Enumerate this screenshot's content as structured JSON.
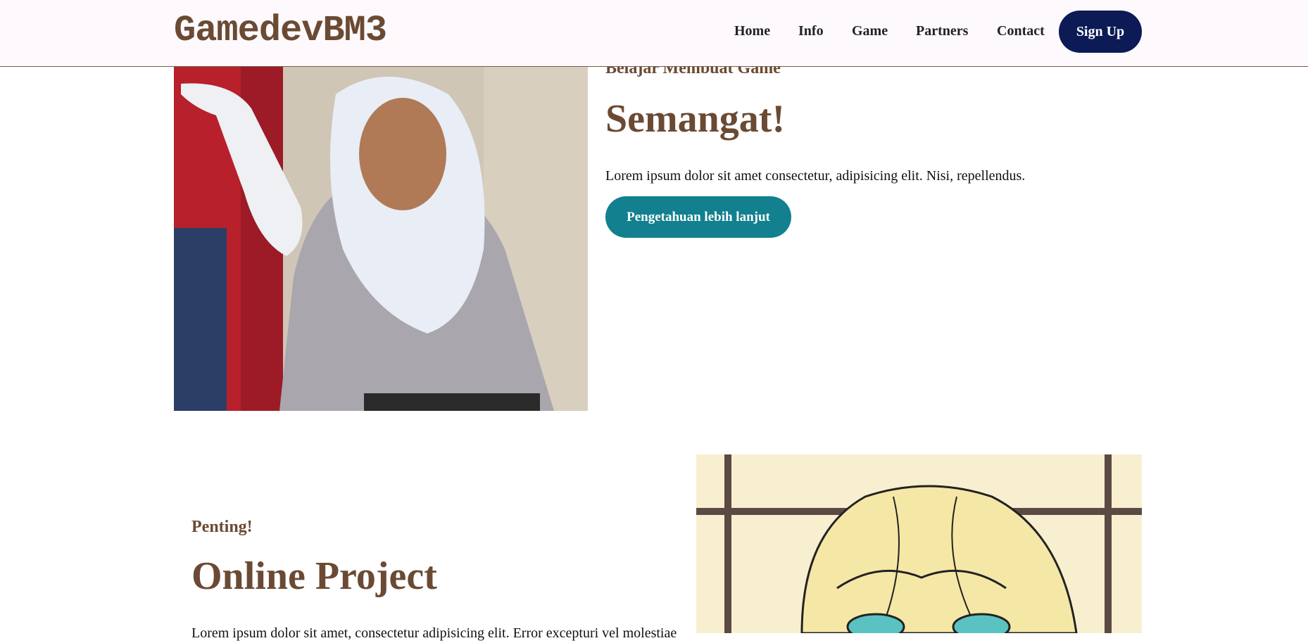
{
  "header": {
    "logo": "GamedevBM3",
    "nav": [
      "Home",
      "Info",
      "Game",
      "Partners",
      "Contact"
    ],
    "signup": "Sign Up"
  },
  "hero": {
    "kicker": "Belajar Membuat Game",
    "title": "Semangat!",
    "paragraph": "Lorem ipsum dolor sit amet consectetur, adipisicing elit. Nisi, repellendus.",
    "cta": "Pengetahuan lebih lanjut"
  },
  "project": {
    "kicker": "Penting!",
    "title": "Online Project",
    "paragraph": "Lorem ipsum dolor sit amet, consectetur adipisicing elit. Error excepturi vel molestiae"
  },
  "colors": {
    "brand_brown": "#6b4a33",
    "signup_bg": "#0c1a55",
    "cta_bg": "#12808e"
  }
}
